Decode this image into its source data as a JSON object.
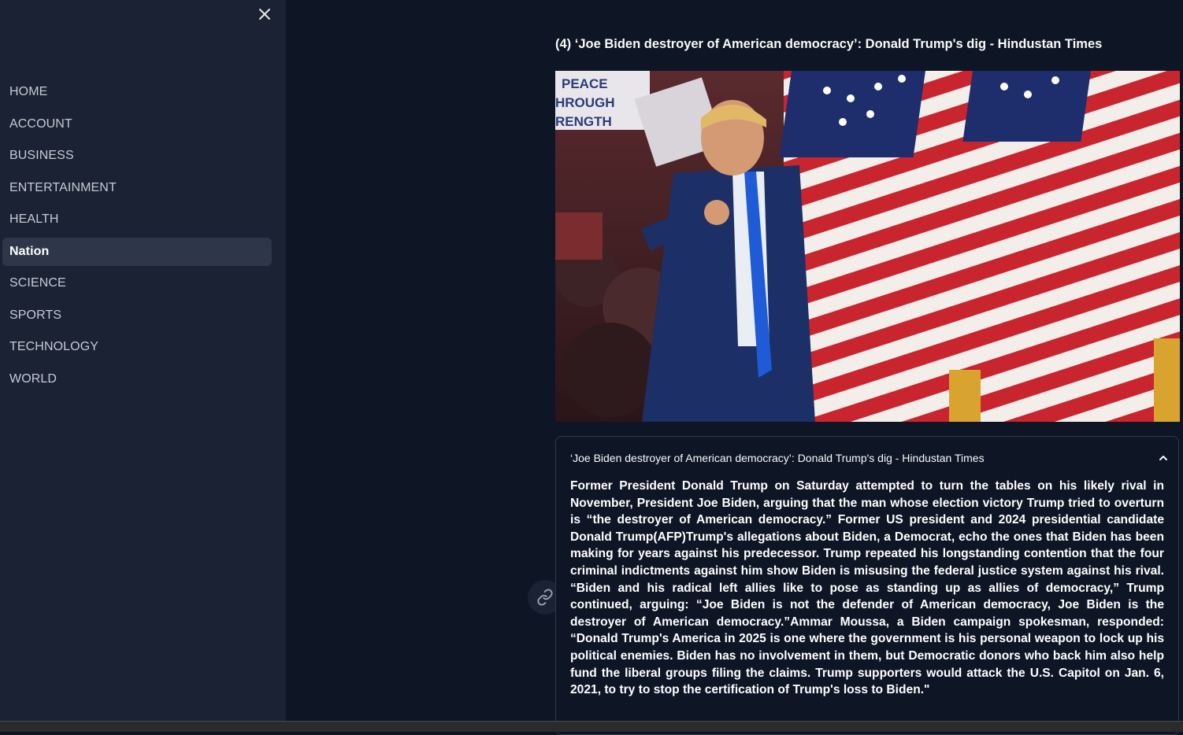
{
  "sidebar": {
    "close_icon": "close-icon",
    "items": [
      {
        "label": "HOME"
      },
      {
        "label": "ACCOUNT"
      },
      {
        "label": "BUSINESS"
      },
      {
        "label": "ENTERTAINMENT"
      },
      {
        "label": "HEALTH"
      },
      {
        "label": "Nation",
        "active": true
      },
      {
        "label": "SCIENCE"
      },
      {
        "label": "SPORTS"
      },
      {
        "label": "TECHNOLOGY"
      },
      {
        "label": "WORLD"
      }
    ]
  },
  "article": {
    "title": "(4) ‘Joe Biden destroyer of American democracy’: Donald Trump's dig - Hindustan Times",
    "image_sign_lines": [
      "PEACE",
      "HROUGH",
      "RENGTH"
    ],
    "link_icon": "link-icon",
    "expander": {
      "header": "‘Joe Biden destroyer of American democracy’: Donald Trump's dig - Hindustan Times",
      "toggle_icon": "chevron-up-icon",
      "body": "Former President Donald Trump on Saturday attempted to turn the tables on his likely rival in November, President Joe Biden, arguing that the man whose election victory Trump tried to overturn is “the destroyer of American democracy.” Former US president and 2024 presidential candidate Donald Trump(AFP)Trump's allegations about Biden, a Democrat, echo the ones that Biden has been making for years against his predecessor. Trump repeated his longstanding contention that the four criminal indictments against him show Biden is misusing the federal justice system against his rival. “Biden and his radical left allies like to pose as standing up as allies of democracy,” Trump continued, arguing: “Joe Biden is not the defender of American democracy, Joe Biden is the destroyer of American democracy.”Ammar Moussa, a Biden campaign spokesman, responded: “Donald Trump's America in 2025 is one where the government is his personal weapon to lock up his political enemies. Biden has no involvement in them, but Democratic donors who back him also help fund the liberal groups filing the claims. Trump supporters would attack the U.S. Capitol on Jan. 6, 2021, to try to stop the certification of Trump's loss to Biden.\""
    }
  },
  "colors": {
    "sidebar_bg": "#1a2233",
    "main_bg": "#0e1525",
    "active_item_bg": "#2d3749",
    "text": "#fafafa"
  }
}
